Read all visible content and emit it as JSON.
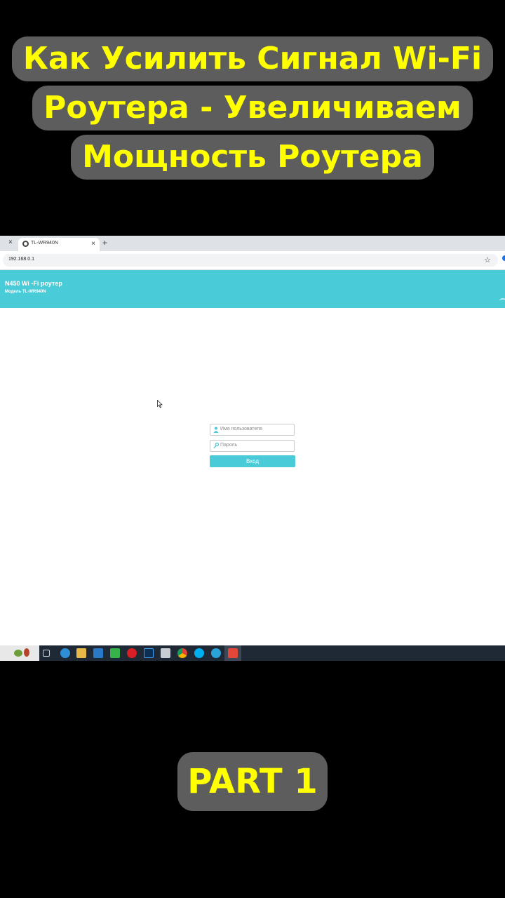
{
  "overlay": {
    "title_lines": [
      "Как Усилить Сигнал Wi-Fi",
      "Роутера - Увеличиваем",
      "Мощность Роутера"
    ],
    "part_label": "PART 1",
    "text_color": "#ffff00",
    "box_color": "#5d5d5d"
  },
  "browser": {
    "prev_tab_close": "×",
    "tab": {
      "title": "TL-WR940N",
      "close": "×"
    },
    "new_tab": "+",
    "address": {
      "url": "192.168.0.1",
      "info_icon": "o",
      "star": "☆"
    }
  },
  "router": {
    "title": "N450 Wi -Fi роутер",
    "model": "Модель TL-WR940N",
    "accent": "#4acbd8",
    "login": {
      "username_placeholder": "Имя пользователя",
      "password_placeholder": "Пароль",
      "submit_label": "Вход"
    }
  },
  "taskbar": {
    "icons": [
      "task-view-icon",
      "edge-icon",
      "file-explorer-icon",
      "mail-icon",
      "camtasia-icon",
      "opera-icon",
      "photoshop-icon",
      "calculator-icon",
      "chrome-icon",
      "skype-icon",
      "telegram-icon",
      "recorder-icon"
    ]
  }
}
